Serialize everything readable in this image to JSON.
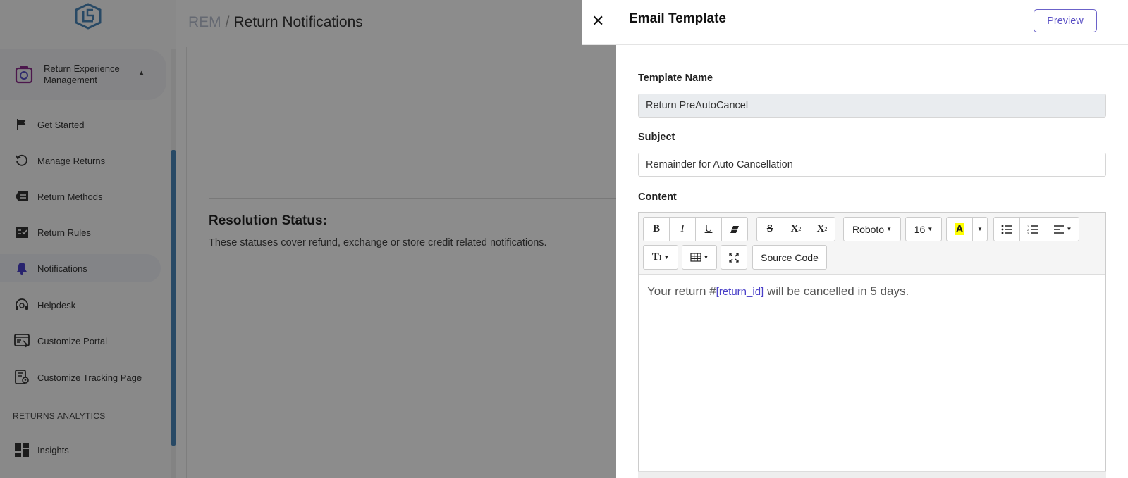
{
  "header": {
    "breadcrumb_root": "REM",
    "breadcrumb_sep": "/",
    "page_title": "Return Notifications"
  },
  "sidebar": {
    "group_label": "Return Experience Management",
    "items": [
      {
        "label": "Get Started",
        "icon": "flag-icon"
      },
      {
        "label": "Manage Returns",
        "icon": "history-icon"
      },
      {
        "label": "Return Methods",
        "icon": "list-card-icon"
      },
      {
        "label": "Return Rules",
        "icon": "checklist-icon"
      },
      {
        "label": "Notifications",
        "icon": "bell-icon",
        "active": true
      },
      {
        "label": "Helpdesk",
        "icon": "headset-icon"
      },
      {
        "label": "Customize Portal",
        "icon": "portal-icon"
      },
      {
        "label": "Customize Tracking Page",
        "icon": "tracking-page-icon"
      }
    ],
    "section_label": "RETURNS ANALYTICS",
    "analytics_items": [
      {
        "label": "Insights",
        "icon": "dashboard-icon"
      }
    ]
  },
  "main": {
    "section_title": "Resolution Status:",
    "section_desc": "These statuses cover refund, exchange or store credit related notifications."
  },
  "drawer": {
    "title": "Email Template",
    "preview_label": "Preview",
    "template_name_label": "Template Name",
    "template_name_value": "Return PreAutoCancel",
    "subject_label": "Subject",
    "subject_value": "Remainder for Auto Cancellation",
    "content_label": "Content",
    "toolbar": {
      "font": "Roboto",
      "size": "16",
      "source_code": "Source Code"
    },
    "content_text_before": "Your return #",
    "content_variable": "[return_id]",
    "content_text_after": " will be cancelled in 5 days."
  },
  "colors": {
    "accent": "#5a50c5",
    "overlay": "rgba(0,0,0,0.45)",
    "scroll_thumb": "#4a86b8"
  }
}
